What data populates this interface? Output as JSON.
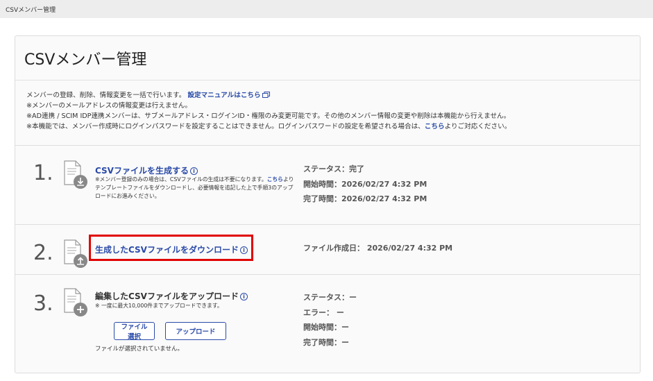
{
  "window": {
    "title": "CSVメンバー管理"
  },
  "card": {
    "title": "CSVメンバー管理"
  },
  "notes": {
    "line1_text": "メンバーの登録、削除、情報変更を一括で行います。",
    "line1_link": "設定マニュアルはこちら",
    "line2": "※メンバーのメールアドレスの情報変更は行えません。",
    "line3": "※AD連携 / SCIM IDP連携メンバーは、サブメールアドレス・ログインID・権限のみ変更可能です。その他のメンバー情報の変更や削除は本機能から行えません。",
    "line4_pre": "※本機能では、メンバー作成時にログインパスワードを設定することはできません。ログインパスワードの設定を希望される場合は、",
    "line4_link": "こちら",
    "line4_post": "よりご対応ください。"
  },
  "steps": [
    {
      "number": "1.",
      "title": "CSVファイルを生成する",
      "desc_pre": "※メンバー登録のみの場合は、CSVファイルの生成は不要になります。",
      "desc_link": "こちら",
      "desc_post": "よりテンプレートファイルをダウンロードし、必要情報を追記した上で手順3のアップロードにお進みください。",
      "status": [
        "ステータス：完了",
        "開始時間：2026/02/27 4:32 PM",
        "完了時間：2026/02/27 4:32 PM"
      ],
      "icon": "download-document-icon"
    },
    {
      "number": "2.",
      "title": "生成したCSVファイルをダウンロード",
      "status": [
        "ファイル作成日： 2026/02/27 4:32 PM"
      ],
      "icon": "upload-document-icon"
    },
    {
      "number": "3.",
      "title": "編集したCSVファイルをアップロード",
      "desc": "※ 一度に最大10,000件までアップロードできます。",
      "select_button": "ファイル選択",
      "upload_button": "アップロード",
      "no_file": "ファイルが選択されていません。",
      "status": [
        "ステータス：ー",
        "エラー： ー",
        "開始時間：ー",
        "完了時間：ー"
      ],
      "icon": "add-document-icon"
    }
  ],
  "colors": {
    "link": "#2a4aa8",
    "highlight": "#e00000",
    "icon_gray": "#888888"
  }
}
